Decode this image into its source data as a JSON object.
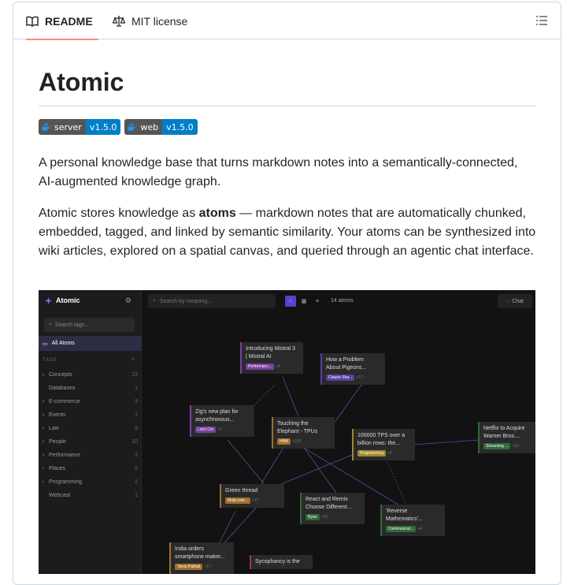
{
  "tabs": [
    {
      "label": "README",
      "active": true
    },
    {
      "label": "MIT license",
      "active": false
    }
  ],
  "title": "Atomic",
  "badges": [
    {
      "label": "server",
      "version": "v1.5.0"
    },
    {
      "label": "web",
      "version": "v1.5.0"
    }
  ],
  "intro": "A personal knowledge base that turns markdown notes into a semantically-connected, AI-augmented knowledge graph.",
  "body_pre": "Atomic stores knowledge as ",
  "body_bold": "atoms",
  "body_post": " — markdown notes that are automatically chunked, embedded, tagged, and linked by semantic similarity. Your atoms can be synthesized into wiki articles, explored on a spatial canvas, and queried through an agentic chat interface.",
  "app": {
    "brand": "Atomic",
    "search_tags": "Search tags...",
    "all_atoms": "All Atoms",
    "tags_header": "TAGS",
    "tags": [
      {
        "name": "Concepts",
        "count": "13",
        "expandable": true
      },
      {
        "name": "Databases",
        "count": "1",
        "expandable": false
      },
      {
        "name": "E-commerce",
        "count": "3",
        "expandable": true
      },
      {
        "name": "Events",
        "count": "1",
        "expandable": true
      },
      {
        "name": "Law",
        "count": "9",
        "expandable": true
      },
      {
        "name": "People",
        "count": "10",
        "expandable": true
      },
      {
        "name": "Performance",
        "count": "3",
        "expandable": true
      },
      {
        "name": "Places",
        "count": "5",
        "expandable": true
      },
      {
        "name": "Programming",
        "count": "2",
        "expandable": true
      },
      {
        "name": "Webcast",
        "count": "1",
        "expandable": false
      }
    ],
    "search_placeholder": "Search by meaning...",
    "atom_count": "14 atoms",
    "chat_label": "Chat",
    "cards": [
      {
        "t1": "Introducing Mistral 3",
        "t2": "| Mistral AI",
        "pill": "Performanc...",
        "more": "+4",
        "color": "#7b3fa0"
      },
      {
        "t1": "How a Problem",
        "t2": "About Pigeons...",
        "pill": "Claude Sha...",
        "more": "+12",
        "color": "#5b3fa0"
      },
      {
        "t1": "Zig's new plan for",
        "t2": "asynchronous...",
        "pill": "Loris Cro",
        "more": "+7",
        "color": "#7b3fa0"
      },
      {
        "t1": "Touching the",
        "t2": "Elephant - TPUs",
        "pill": "HBM",
        "more": "+153",
        "color": "#a0702a"
      },
      {
        "t1": "100000 TPS over a",
        "t2": "billion rows: the...",
        "pill": "Programming",
        "more": "+3",
        "color": "#a08a2a"
      },
      {
        "t1": "Netflix to Acquire",
        "t2": "Warner Bros....",
        "pill": "Streaming ...",
        "more": "+10",
        "color": "#2f6a3a"
      },
      {
        "t1": "Green thread",
        "t2": "",
        "pill": "Multi-core...",
        "more": "+77",
        "color": "#a0702a"
      },
      {
        "t1": "React and Remix",
        "t2": "Choose Different...",
        "pill": "Ryan",
        "more": "+10",
        "color": "#2f6a3a"
      },
      {
        "t1": "'Reverse",
        "t2": "Mathematics'...",
        "pill": "Communicat...",
        "more": "+4",
        "color": "#2f6a3a"
      },
      {
        "t1": "India orders",
        "t2": "smartphone maker...",
        "pill": "Tarun Pathak",
        "more": "+17",
        "color": "#a0702a"
      },
      {
        "t1": "Sycophancy is the",
        "t2": "",
        "pill": "",
        "more": "",
        "color": "#a03a4a"
      }
    ]
  }
}
